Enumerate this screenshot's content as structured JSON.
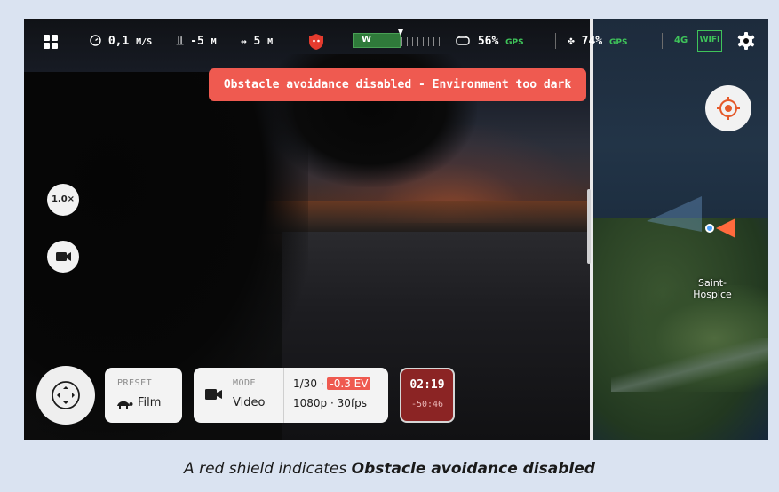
{
  "topbar": {
    "speed_value": "0,1",
    "speed_unit": "M/S",
    "altitude": "-5",
    "altitude_unit": "M",
    "distance": "5",
    "distance_unit": "M",
    "attitude_label": "W",
    "controller_battery": "56%",
    "controller_gps": "GPS",
    "drone_battery": "74%",
    "drone_gps": "GPS",
    "network": "4G",
    "wifi": "WIFI"
  },
  "alert": {
    "text": "Obstacle avoidance disabled - Environment too dark",
    "color": "#ef5a50"
  },
  "camera": {
    "zoom": "1.0×"
  },
  "map": {
    "place_name": "Saint-\nHospice"
  },
  "bottom": {
    "preset_label": "PRESET",
    "preset_value": "Film",
    "mode_label": "MODE",
    "mode_value": "Video",
    "shutter": "1/30",
    "ev": "-0.3 EV",
    "format": "1080p · 30fps",
    "rec_time": "02:19",
    "rec_remaining": "-50:46"
  },
  "caption": {
    "prefix": "A red shield indicates ",
    "bold": "Obstacle avoidance disabled"
  },
  "colors": {
    "alert_red": "#ef5a50",
    "shield_red": "#e43b2e",
    "status_green": "#3fc45a",
    "record_red": "#8b2424",
    "frame_bg": "#dae3f1"
  }
}
